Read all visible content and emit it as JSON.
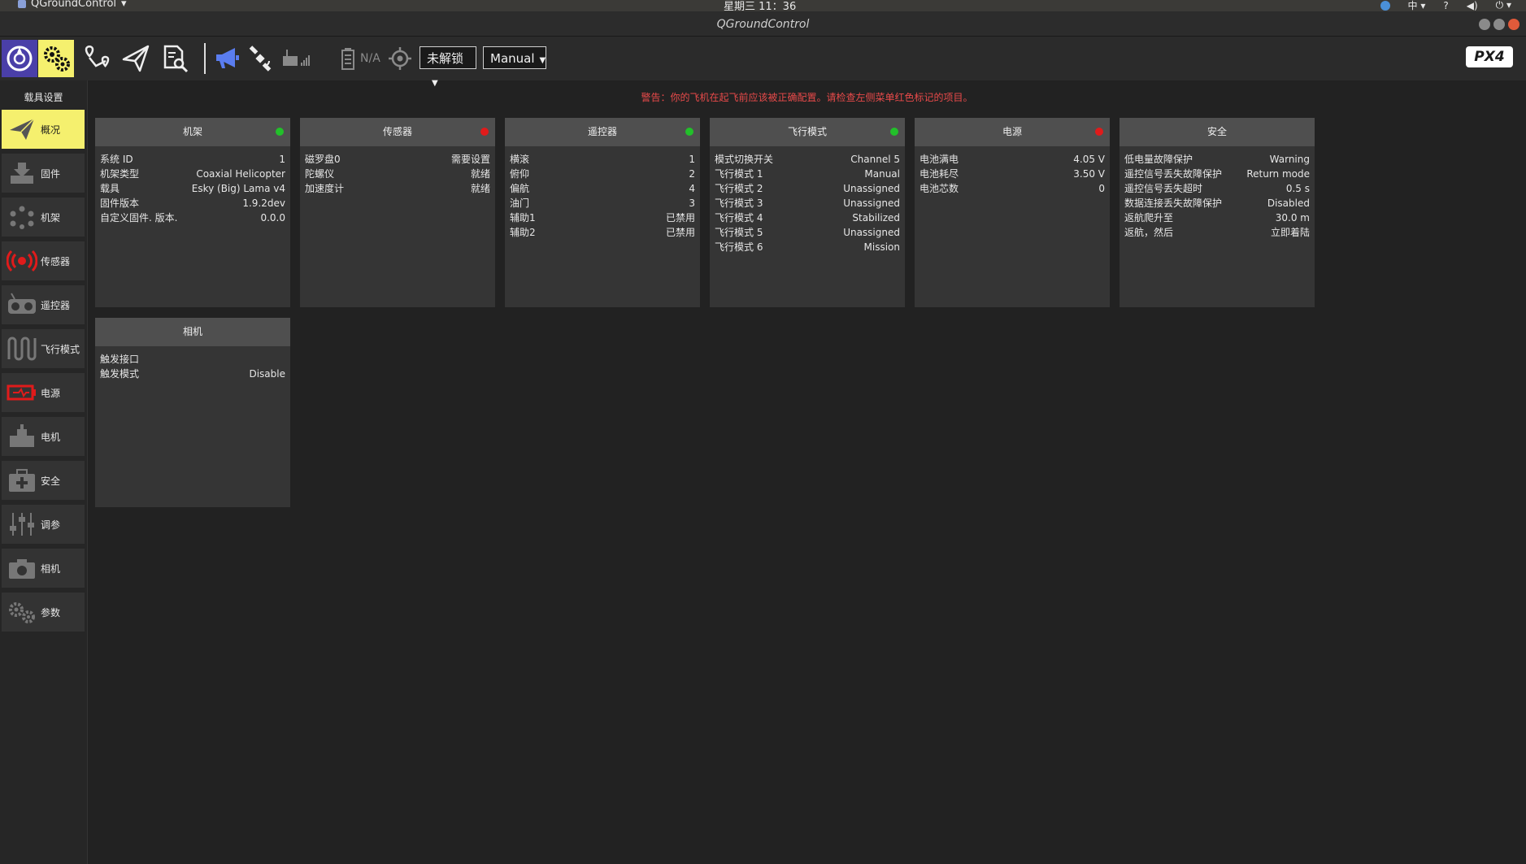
{
  "os": {
    "app_menu": "QGroundControl",
    "clock": "星期三 11：36",
    "ime": "中",
    "help": "?"
  },
  "window": {
    "title": "QGroundControl"
  },
  "toolbar": {
    "arm_state": "未解锁",
    "flight_mode": "Manual",
    "battery_text": "N/A",
    "brand": "PX4"
  },
  "sidebar": {
    "header": "载具设置",
    "items": [
      {
        "label": "概况",
        "icon": "paper-plane-icon"
      },
      {
        "label": "固件",
        "icon": "download-icon"
      },
      {
        "label": "机架",
        "icon": "airframe-icon"
      },
      {
        "label": "传感器",
        "icon": "radio-waves-icon"
      },
      {
        "label": "遥控器",
        "icon": "radio-controller-icon"
      },
      {
        "label": "飞行模式",
        "icon": "wave-icon"
      },
      {
        "label": "电源",
        "icon": "battery-icon"
      },
      {
        "label": "电机",
        "icon": "motor-icon"
      },
      {
        "label": "安全",
        "icon": "first-aid-icon"
      },
      {
        "label": "调参",
        "icon": "sliders-icon"
      },
      {
        "label": "相机",
        "icon": "camera-icon"
      },
      {
        "label": "参数",
        "icon": "gears-icon"
      }
    ]
  },
  "warning": "警告：你的飞机在起飞前应该被正确配置。请检查左侧菜单红色标记的项目。",
  "colors": {
    "ok": "#22c02a",
    "error": "#e01b1b",
    "active": "#f5f06e"
  },
  "panels": [
    {
      "title": "机架",
      "status": "ok",
      "rows": [
        {
          "label": "系统 ID",
          "value": "1"
        },
        {
          "label": "机架类型",
          "value": "Coaxial Helicopter"
        },
        {
          "label": "载具",
          "value": "Esky (Big) Lama v4"
        },
        {
          "label": "固件版本",
          "value": "1.9.2dev"
        },
        {
          "label": "自定义固件. 版本.",
          "value": "0.0.0"
        }
      ]
    },
    {
      "title": "传感器",
      "status": "error",
      "rows": [
        {
          "label": "磁罗盘0",
          "value": "需要设置"
        },
        {
          "label": "陀螺仪",
          "value": "就绪"
        },
        {
          "label": "加速度计",
          "value": "就绪"
        }
      ]
    },
    {
      "title": "遥控器",
      "status": "ok",
      "rows": [
        {
          "label": "横滚",
          "value": "1"
        },
        {
          "label": "俯仰",
          "value": "2"
        },
        {
          "label": "偏航",
          "value": "4"
        },
        {
          "label": "油门",
          "value": "3"
        },
        {
          "label": "辅助1",
          "value": "已禁用"
        },
        {
          "label": "辅助2",
          "value": "已禁用"
        }
      ]
    },
    {
      "title": "飞行模式",
      "status": "ok",
      "rows": [
        {
          "label": "模式切换开关",
          "value": "Channel 5"
        },
        {
          "label": "飞行模式 1",
          "value": "Manual"
        },
        {
          "label": "飞行模式 2",
          "value": "Unassigned"
        },
        {
          "label": "飞行模式 3",
          "value": "Unassigned"
        },
        {
          "label": "飞行模式 4",
          "value": "Stabilized"
        },
        {
          "label": "飞行模式 5",
          "value": "Unassigned"
        },
        {
          "label": "飞行模式 6",
          "value": "Mission"
        }
      ]
    },
    {
      "title": "电源",
      "status": "error",
      "rows": [
        {
          "label": "电池满电",
          "value": "4.05 V"
        },
        {
          "label": "电池耗尽",
          "value": "3.50 V"
        },
        {
          "label": "电池芯数",
          "value": "0"
        }
      ]
    },
    {
      "title": "安全",
      "status": "none",
      "rows": [
        {
          "label": "低电量故障保护",
          "value": "Warning"
        },
        {
          "label": "遥控信号丢失故障保护",
          "value": "Return mode"
        },
        {
          "label": "遥控信号丢失超时",
          "value": "0.5 s"
        },
        {
          "label": "数据连接丢失故障保护",
          "value": "Disabled"
        },
        {
          "label": "返航爬升至",
          "value": "30.0 m"
        },
        {
          "label": "返航，然后",
          "value": "立即着陆"
        }
      ]
    },
    {
      "title": "相机",
      "status": "none",
      "rows": [
        {
          "label": "触发接口",
          "value": ""
        },
        {
          "label": "触发模式",
          "value": "Disable"
        }
      ]
    }
  ]
}
